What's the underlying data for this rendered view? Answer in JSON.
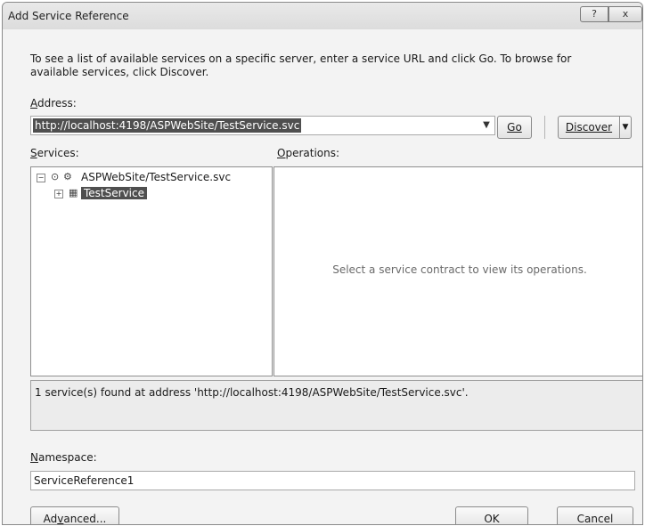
{
  "window": {
    "title": "Add Service Reference",
    "help_glyph": "?",
    "close_glyph": "x"
  },
  "description": "To see a list of available services on a specific server, enter a service URL and click Go. To browse for available services, click Discover.",
  "address": {
    "label": "Address:",
    "value": "http://localhost:4198/ASPWebSite/TestService.svc"
  },
  "buttons": {
    "go": "Go",
    "discover": "Discover",
    "advanced": "Advanced...",
    "ok": "OK",
    "cancel": "Cancel"
  },
  "services": {
    "label": "Services:",
    "tree": [
      {
        "label": "ASPWebSite/TestService.svc",
        "expander": "−"
      },
      {
        "label": "TestService",
        "expander": "+",
        "selected": true
      }
    ]
  },
  "operations": {
    "label": "Operations:",
    "placeholder": "Select a service contract to view its operations."
  },
  "status_message": "1 service(s) found at address 'http://localhost:4198/ASPWebSite/TestService.svc'.",
  "namespace": {
    "label": "Namespace:",
    "value": "ServiceReference1"
  }
}
